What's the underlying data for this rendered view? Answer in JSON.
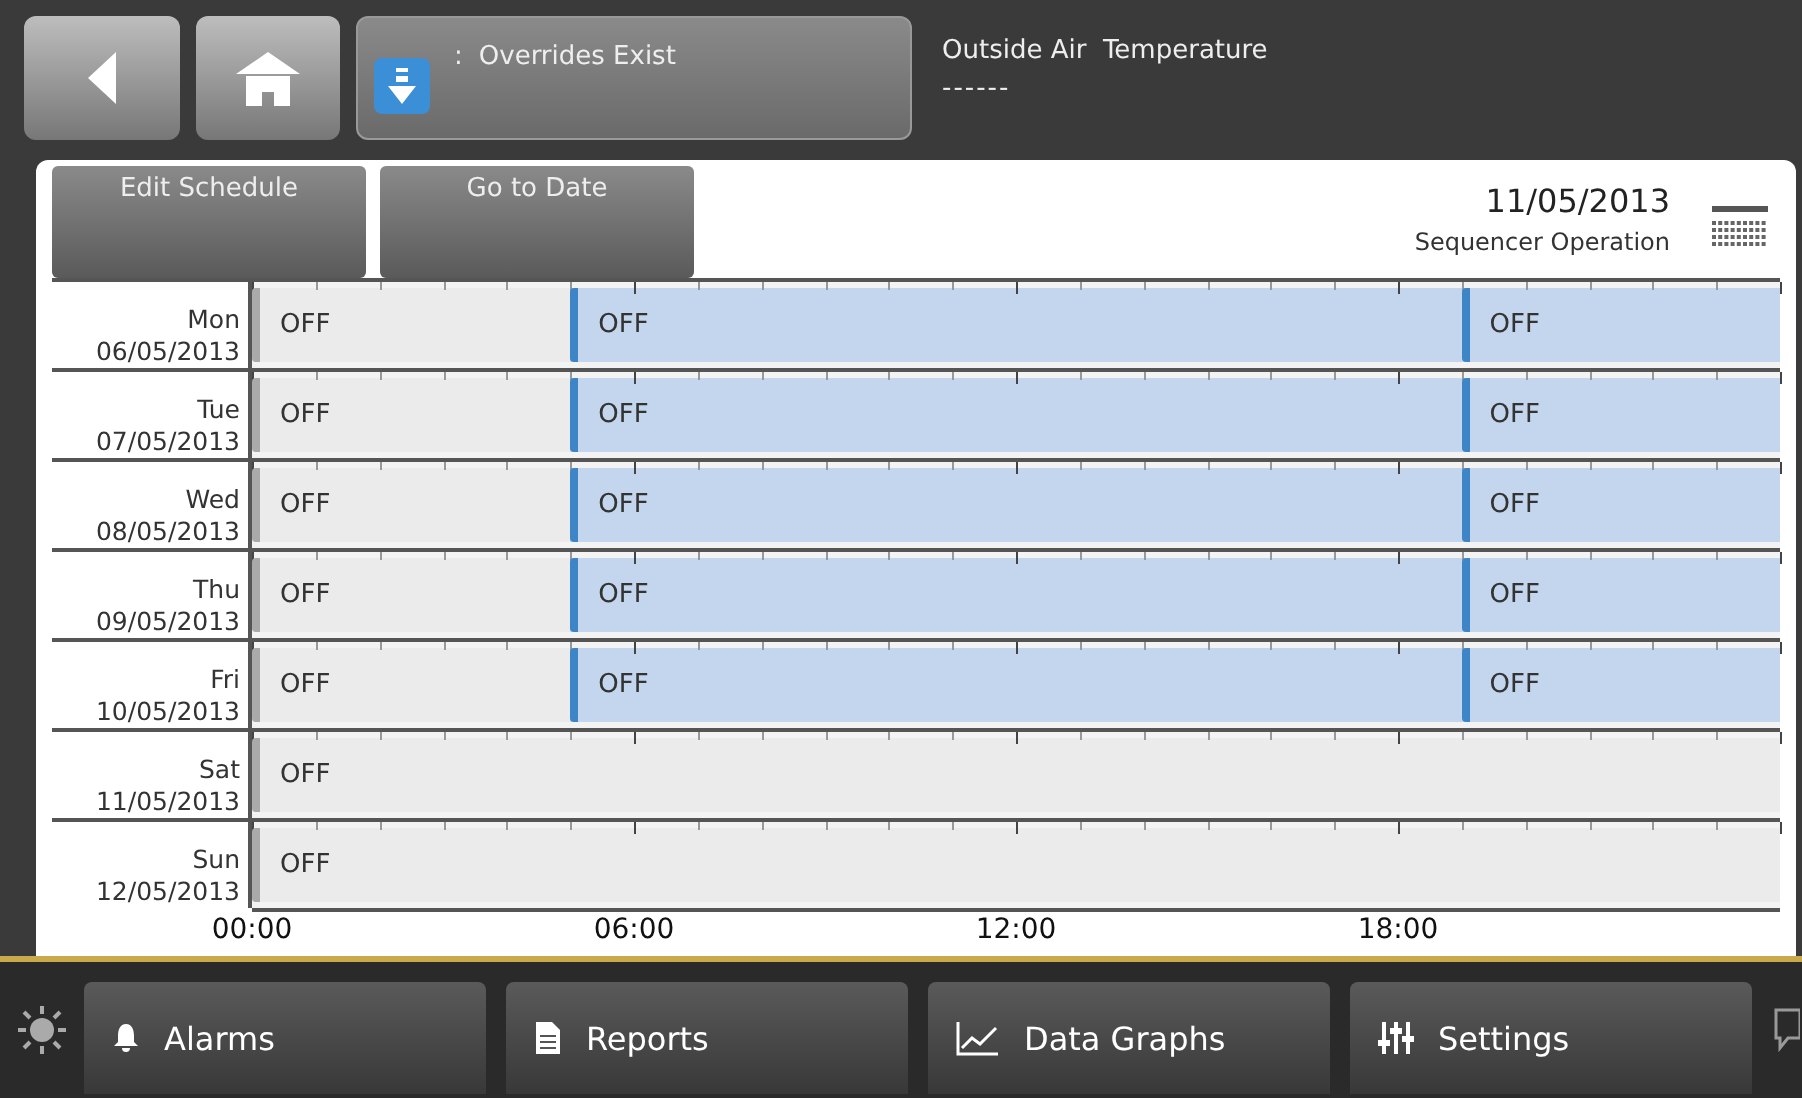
{
  "header": {
    "status": "Overrides Exist",
    "status_separator": ":",
    "reading_label": "Outside Air  Temperature",
    "reading_value": "------"
  },
  "toolbar": {
    "buttons": [
      "Edit Schedule",
      "Go to Date"
    ],
    "date": "11/05/2013",
    "subtitle": "Sequencer Operation"
  },
  "schedule": {
    "days": [
      {
        "day": "Mon",
        "date": "06/05/2013",
        "segments": [
          {
            "label": "OFF",
            "level": 0.2083,
            "kind": "idle"
          },
          {
            "label": "OFF",
            "level": 0.7368,
            "kind": "scheduled"
          },
          {
            "label": "OFF",
            "level": 1,
            "kind": "scheduled"
          }
        ]
      },
      {
        "day": "Tue",
        "date": "07/05/2013",
        "segments": [
          {
            "label": "OFF",
            "level": 0.2083,
            "kind": "idle"
          },
          {
            "label": "OFF",
            "level": 0.7368,
            "kind": "scheduled"
          },
          {
            "label": "OFF",
            "level": 1,
            "kind": "scheduled"
          }
        ]
      },
      {
        "day": "Wed",
        "date": "08/05/2013",
        "segments": [
          {
            "label": "OFF",
            "level": 0.2083,
            "kind": "idle"
          },
          {
            "label": "OFF",
            "level": 0.7368,
            "kind": "scheduled"
          },
          {
            "label": "OFF",
            "level": 1,
            "kind": "scheduled"
          }
        ]
      },
      {
        "day": "Thu",
        "date": "09/05/2013",
        "segments": [
          {
            "label": "OFF",
            "level": 0.2083,
            "kind": "idle"
          },
          {
            "label": "OFF",
            "level": 0.7368,
            "kind": "scheduled"
          },
          {
            "label": "OFF",
            "level": 1,
            "kind": "scheduled"
          }
        ]
      },
      {
        "day": "Fri",
        "date": "10/05/2013",
        "segments": [
          {
            "label": "OFF",
            "level": 0.2083,
            "kind": "idle"
          },
          {
            "label": "OFF",
            "level": 0.7368,
            "kind": "scheduled"
          },
          {
            "label": "OFF",
            "level": 1,
            "kind": "scheduled"
          }
        ]
      },
      {
        "day": "Sat",
        "date": "11/05/2013",
        "segments": [
          {
            "label": "OFF",
            "level": 1,
            "kind": "idle"
          }
        ]
      },
      {
        "day": "Sun",
        "date": "12/05/2013",
        "segments": [
          {
            "label": "OFF",
            "level": 1,
            "kind": "idle"
          }
        ]
      }
    ],
    "axis": [
      "00:00",
      "06:00",
      "12:00",
      "18:00"
    ]
  },
  "nav": [
    {
      "label": "Alarms",
      "kind": "alarms"
    },
    {
      "label": "Reports",
      "kind": "reports"
    },
    {
      "label": "Data Graphs",
      "kind": "graphs"
    },
    {
      "label": "Settings",
      "kind": "settings"
    }
  ]
}
